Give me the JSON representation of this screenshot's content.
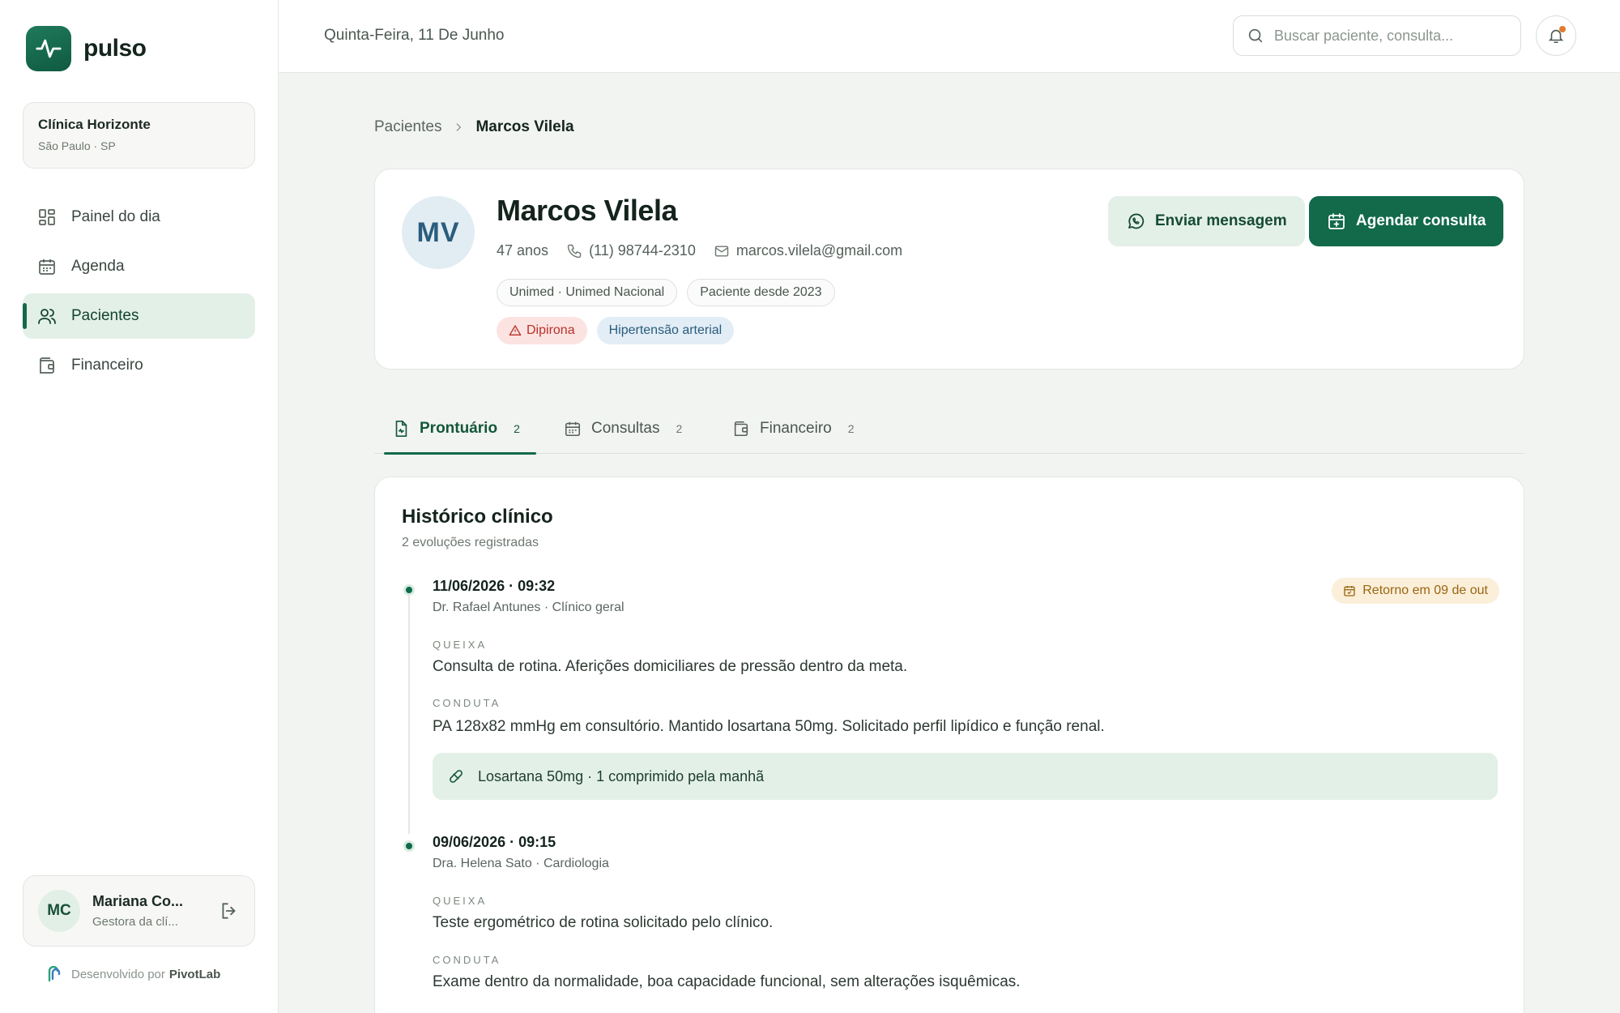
{
  "brand": {
    "name": "pulso"
  },
  "clinic": {
    "name": "Clínica Horizonte",
    "location": "São Paulo · SP"
  },
  "nav": {
    "items": [
      {
        "label": "Painel do dia",
        "icon": "grid-icon"
      },
      {
        "label": "Agenda",
        "icon": "calendar-icon"
      },
      {
        "label": "Pacientes",
        "icon": "users-icon",
        "active": true
      },
      {
        "label": "Financeiro",
        "icon": "wallet-icon"
      }
    ]
  },
  "user": {
    "initials": "MC",
    "name": "Mariana Co...",
    "role": "Gestora da clí..."
  },
  "credit": {
    "prefix": "Desenvolvido por",
    "company": "PivotLab"
  },
  "topbar": {
    "date": "Quinta-Feira, 11 De Junho",
    "search_placeholder": "Buscar paciente, consulta..."
  },
  "breadcrumb": {
    "parent": "Pacientes",
    "current": "Marcos Vilela"
  },
  "patient": {
    "initials": "MV",
    "name": "Marcos Vilela",
    "age": "47 anos",
    "phone": "(11) 98744-2310",
    "email": "marcos.vilela@gmail.com",
    "insurance": "Unimed · Unimed Nacional",
    "since": "Paciente desde 2023",
    "allergy": "Dipirona",
    "condition": "Hipertensão arterial"
  },
  "actions": {
    "message": "Enviar mensagem",
    "schedule": "Agendar consulta"
  },
  "tabs": [
    {
      "label": "Prontuário",
      "count": "2",
      "active": true
    },
    {
      "label": "Consultas",
      "count": "2"
    },
    {
      "label": "Financeiro",
      "count": "2"
    }
  ],
  "history": {
    "title": "Histórico clínico",
    "subtitle": "2 evoluções registradas",
    "entries": [
      {
        "datetime": "11/06/2026 · 09:32",
        "doctor": "Dr. Rafael Antunes · Clínico geral",
        "return": "Retorno em 09 de out",
        "complaint_label": "QUEIXA",
        "complaint": "Consulta de rotina. Aferições domiciliares de pressão dentro da meta.",
        "conduct_label": "CONDUTA",
        "conduct": "PA 128x82 mmHg em consultório. Mantido losartana 50mg. Solicitado perfil lipídico e função renal.",
        "prescription": "Losartana 50mg · 1 comprimido pela manhã"
      },
      {
        "datetime": "09/06/2026 · 09:15",
        "doctor": "Dra. Helena Sato · Cardiologia",
        "complaint_label": "QUEIXA",
        "complaint": "Teste ergométrico de rotina solicitado pelo clínico.",
        "conduct_label": "CONDUTA",
        "conduct": "Exame dentro da normalidade, boa capacidade funcional, sem alterações isquêmicas."
      }
    ]
  },
  "colors": {
    "primary": "#126a4b",
    "primary_soft": "#e3f0e8",
    "allergy": "#b8322b",
    "notification": "#e07b2f"
  }
}
